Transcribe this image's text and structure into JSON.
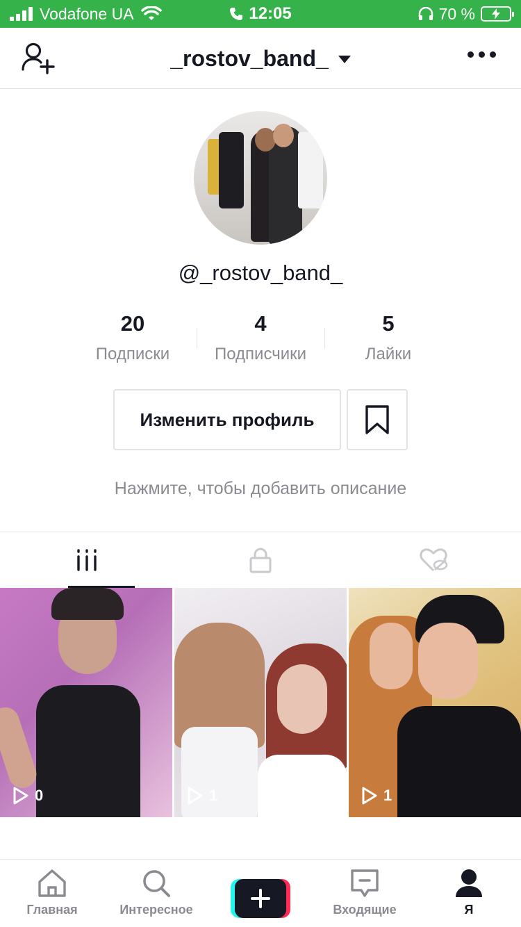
{
  "status_bar": {
    "carrier": "Vodafone UA",
    "time": "12:05",
    "battery_percent": "70 %",
    "signal_bars": 4
  },
  "header": {
    "title": "_rostov_band_",
    "add_user_icon": "add-user-icon",
    "more_icon": "more-icon"
  },
  "profile": {
    "handle": "@_rostov_band_",
    "stats": [
      {
        "value": "20",
        "label": "Подписки"
      },
      {
        "value": "4",
        "label": "Подписчики"
      },
      {
        "value": "5",
        "label": "Лайки"
      }
    ],
    "edit_button_label": "Изменить профиль",
    "bio_placeholder": "Нажмите, чтобы добавить описание"
  },
  "tabs": [
    {
      "icon": "grid-icon",
      "active": true
    },
    {
      "icon": "lock-icon",
      "active": false
    },
    {
      "icon": "liked-hidden-icon",
      "active": false
    }
  ],
  "videos": [
    {
      "views": "0"
    },
    {
      "views": "1"
    },
    {
      "views": "1"
    }
  ],
  "bottom_nav": {
    "items": [
      {
        "label": "Главная",
        "icon": "home-icon"
      },
      {
        "label": "Интересное",
        "icon": "search-icon"
      },
      {
        "label": "",
        "icon": "plus-icon"
      },
      {
        "label": "Входящие",
        "icon": "inbox-icon"
      },
      {
        "label": "Я",
        "icon": "profile-icon"
      }
    ]
  },
  "colors": {
    "status_bar": "#35b34a",
    "text_primary": "#161823",
    "text_secondary": "#8a8b91",
    "divider": "#e3e3e4",
    "create_cyan": "#25f4ee",
    "create_red": "#fe2c55"
  }
}
